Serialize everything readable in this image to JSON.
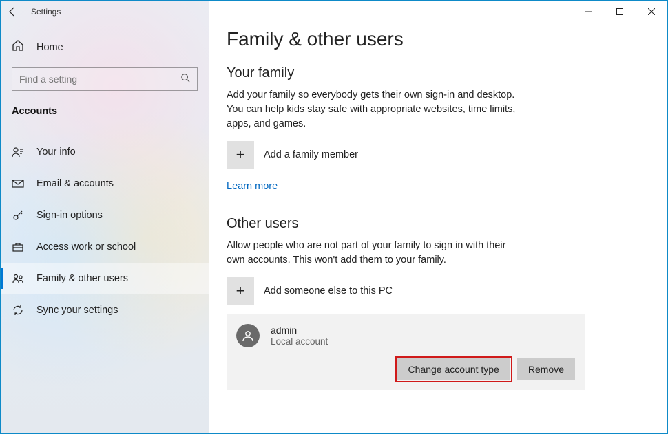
{
  "window": {
    "title": "Settings"
  },
  "sidebar": {
    "home_label": "Home",
    "search_placeholder": "Find a setting",
    "category_label": "Accounts",
    "items": [
      {
        "label": "Your info"
      },
      {
        "label": "Email & accounts"
      },
      {
        "label": "Sign-in options"
      },
      {
        "label": "Access work or school"
      },
      {
        "label": "Family & other users"
      },
      {
        "label": "Sync your settings"
      }
    ]
  },
  "page": {
    "title": "Family & other users",
    "family": {
      "heading": "Your family",
      "description": "Add your family so everybody gets their own sign-in and desktop. You can help kids stay safe with appropriate websites, time limits, apps, and games.",
      "add_label": "Add a family member",
      "learn_more": "Learn more"
    },
    "other": {
      "heading": "Other users",
      "description": "Allow people who are not part of your family to sign in with their own accounts. This won't add them to your family.",
      "add_label": "Add someone else to this PC",
      "user": {
        "name": "admin",
        "subtitle": "Local account",
        "change_btn": "Change account type",
        "remove_btn": "Remove"
      }
    }
  }
}
